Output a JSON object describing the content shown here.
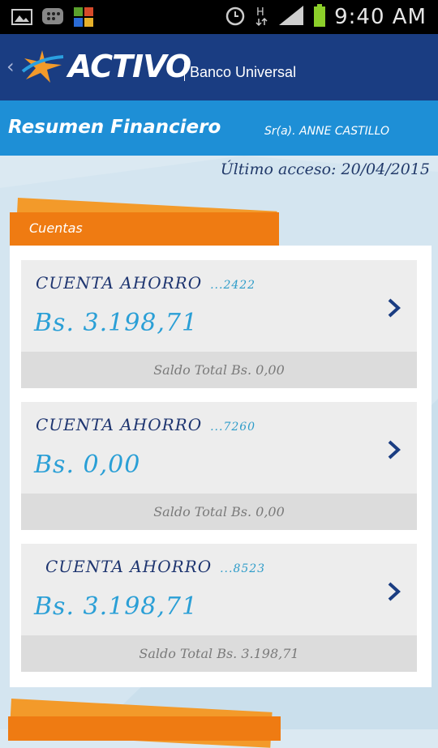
{
  "statusbar": {
    "icons": [
      "image-icon",
      "blackberry-icon",
      "app-icon",
      "alarm-icon",
      "network-h-icon",
      "signal-icon",
      "battery-icon"
    ],
    "time": "9:40 AM"
  },
  "header": {
    "brand": "ACTIVO",
    "brand_sub": "Banco Universal",
    "colors": {
      "header_bg": "#1a3d82",
      "star_orange": "#f39a2a",
      "star_blue": "#2aa0e0"
    }
  },
  "titlebar": {
    "title": "Resumen Financiero",
    "user": "Sr(a). ANNE CASTILLO",
    "color": "#1e8fd6"
  },
  "last_access": "Último acceso: 20/04/2015",
  "section": {
    "label": "Cuentas",
    "color": "#ef7b12"
  },
  "accounts": [
    {
      "type": "CUENTA AHORRO",
      "number": "...2422",
      "amount": "Bs. 3.198,71",
      "total": "Saldo Total Bs. 0,00"
    },
    {
      "type": "CUENTA AHORRO",
      "number": "...7260",
      "amount": "Bs. 0,00",
      "total": "Saldo Total Bs. 0,00"
    },
    {
      "type": "CUENTA AHORRO",
      "number": "...8523",
      "amount": "Bs. 3.198,71",
      "total": "Saldo Total Bs. 3.198,71"
    }
  ],
  "next_section": {
    "label": ""
  }
}
